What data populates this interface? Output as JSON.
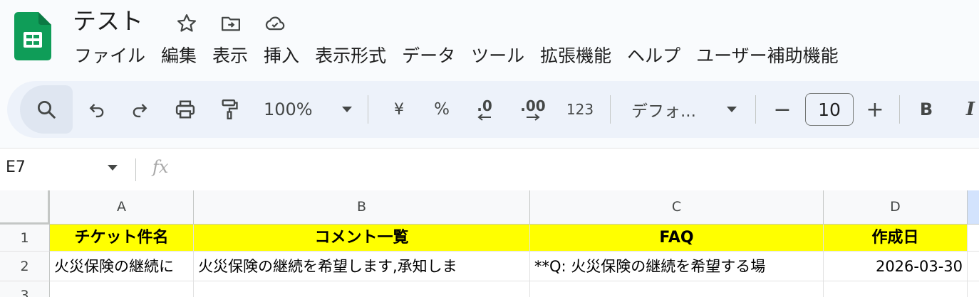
{
  "app": {
    "title": "テスト",
    "menu": [
      "ファイル",
      "編集",
      "表示",
      "挿入",
      "表示形式",
      "データ",
      "ツール",
      "拡張機能",
      "ヘルプ",
      "ユーザー補助機能"
    ]
  },
  "toolbar": {
    "zoom": "100%",
    "currency": "¥",
    "percent": "%",
    "decrease_decimal": ".0",
    "increase_decimal": ".00",
    "number_format": "123",
    "font": "デフォ...",
    "font_size": "10",
    "minus": "−",
    "plus": "+",
    "bold": "B",
    "italic": "I"
  },
  "formula_bar": {
    "cell_ref": "E7",
    "fx": "fx",
    "value": ""
  },
  "sheet": {
    "columns": [
      "A",
      "B",
      "C",
      "D"
    ],
    "rows": [
      "1",
      "2",
      "3"
    ],
    "header_row": [
      "チケット件名",
      "コメント一覧",
      "FAQ",
      "作成日"
    ],
    "data_row": [
      "火災保険の継続に",
      "火災保険の継続を希望します,承知しま",
      "**Q: 火災保険の継続を希望する場",
      "2026-03-30"
    ]
  },
  "colors": {
    "header_fill": "#ffff00",
    "logo_green": "#0f9d58"
  }
}
